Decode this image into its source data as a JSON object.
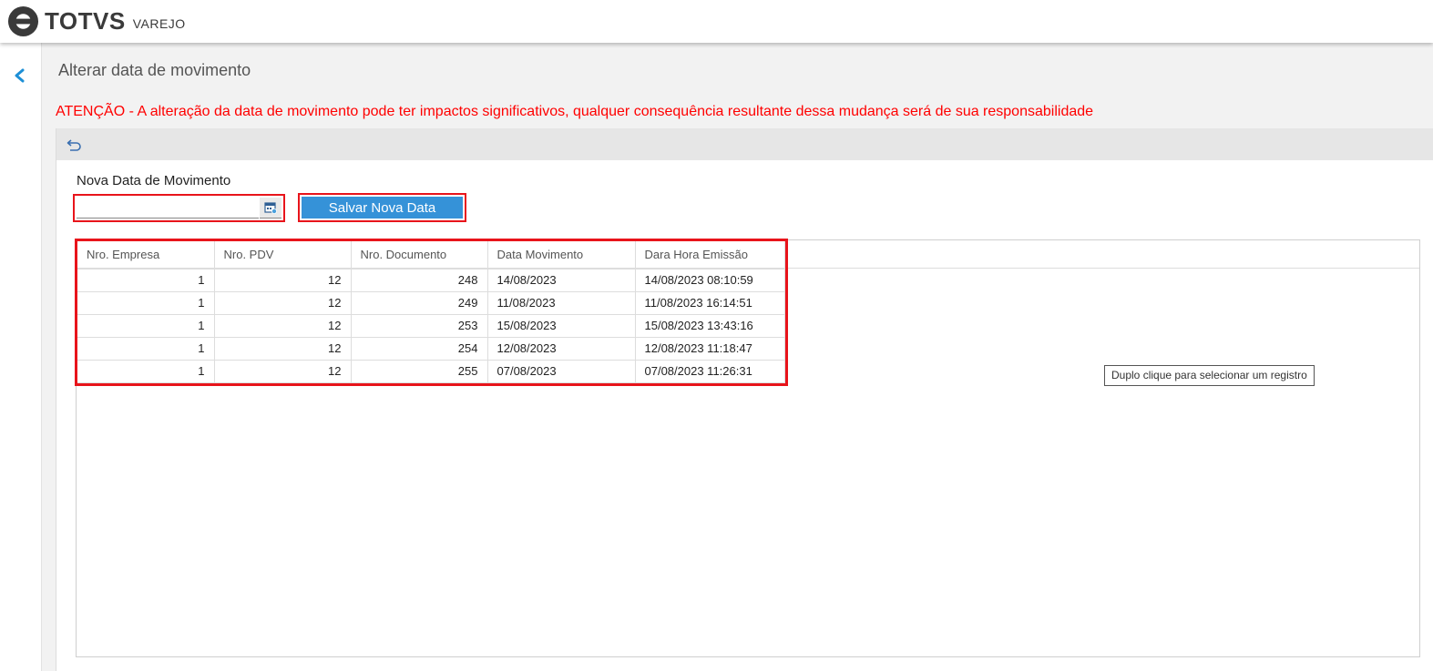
{
  "header": {
    "brand": "TOTVS",
    "product": "VAREJO"
  },
  "page": {
    "title": "Alterar data de movimento",
    "warning": "ATENÇÃO - A alteração da data de movimento pode ter impactos significativos, qualquer consequência resultante dessa mudança será de sua responsabilidade"
  },
  "form": {
    "date_label": "Nova Data de Movimento",
    "date_value": "",
    "save_label": "Salvar Nova Data"
  },
  "table": {
    "columns": [
      "Nro. Empresa",
      "Nro. PDV",
      "Nro. Documento",
      "Data Movimento",
      "Dara Hora Emissão"
    ],
    "rows": [
      [
        "1",
        "12",
        "248",
        "14/08/2023",
        "14/08/2023 08:10:59"
      ],
      [
        "1",
        "12",
        "249",
        "11/08/2023",
        "11/08/2023 16:14:51"
      ],
      [
        "1",
        "12",
        "253",
        "15/08/2023",
        "15/08/2023 13:43:16"
      ],
      [
        "1",
        "12",
        "254",
        "12/08/2023",
        "12/08/2023 11:18:47"
      ],
      [
        "1",
        "12",
        "255",
        "07/08/2023",
        "07/08/2023 11:26:31"
      ]
    ]
  },
  "tooltip": "Duplo clique para selecionar um registro",
  "colors": {
    "accent": "#3592d8",
    "warning": "#ff0000",
    "highlight": "#e8141b"
  },
  "icons": {
    "back": "chevron-left-icon",
    "undo": "undo-icon",
    "calendar": "calendar-icon"
  }
}
